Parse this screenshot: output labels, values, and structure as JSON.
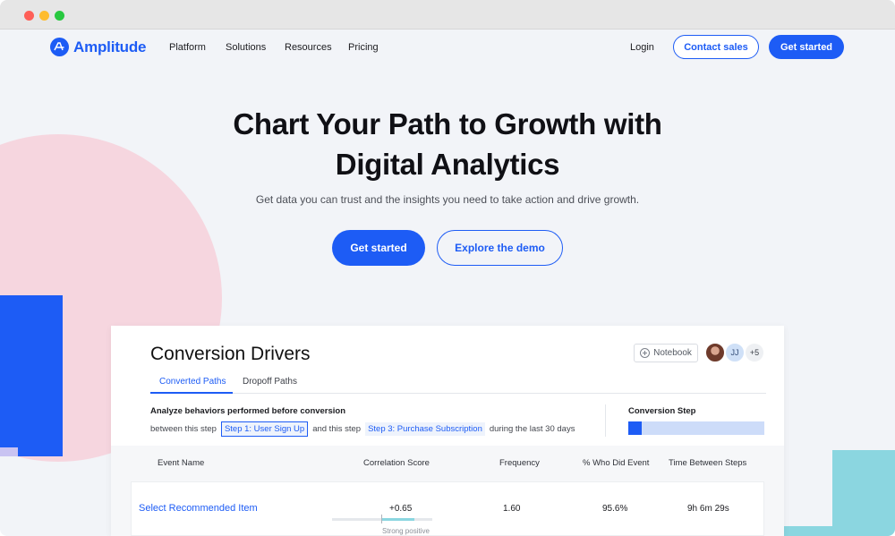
{
  "brand": {
    "name": "Amplitude",
    "color": "#1d5cf5"
  },
  "nav": {
    "links": [
      "Platform",
      "Solutions",
      "Resources",
      "Pricing"
    ],
    "login": "Login",
    "contact_sales": "Contact sales",
    "get_started": "Get started"
  },
  "hero": {
    "title_line1": "Chart Your Path to Growth with",
    "title_line2": "Digital Analytics",
    "subtitle": "Get data you can trust and the insights you need to take action and drive growth.",
    "primary_cta": "Get started",
    "secondary_cta": "Explore the demo"
  },
  "panel": {
    "title": "Conversion Drivers",
    "notebook_label": "Notebook",
    "avatar_initials": "JJ",
    "avatar_more": "+5",
    "tabs": [
      {
        "label": "Converted Paths",
        "active": true
      },
      {
        "label": "Dropoff Paths",
        "active": false
      }
    ],
    "behaviors_title": "Analyze behaviors performed before conversion",
    "between_label": "between this step",
    "step1": "Step 1: User Sign Up",
    "and_label": "and this step",
    "step3": "Step 3: Purchase Subscription",
    "period_label": "during the last 30 days",
    "conversion_step_title": "Conversion Step",
    "conversion_step_progress": 0.1,
    "table": {
      "columns": [
        "Event Name",
        "Correlation Score",
        "Frequency",
        "% Who Did Event",
        "Time Between Steps"
      ],
      "rows": [
        {
          "event_name": "Select Recommended Item",
          "correlation": "+0.65",
          "correlation_value": 0.65,
          "correlation_label": "Strong positive",
          "frequency": "1.60",
          "pct_did_event": "95.6%",
          "time_between": "9h 6m 29s"
        }
      ]
    }
  }
}
